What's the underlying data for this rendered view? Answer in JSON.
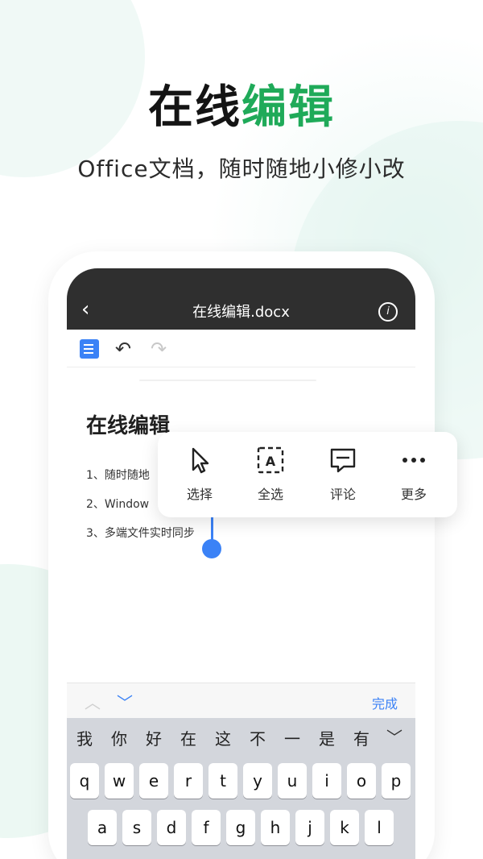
{
  "headline": {
    "part1": "在线",
    "part2": "编辑"
  },
  "subline": "Office文档，随时随地小修小改",
  "app": {
    "title": "在线编辑.docx",
    "back_icon": "chevron-left-icon",
    "info_icon": "info-icon",
    "toolbar": {
      "doc_icon": "document-icon",
      "undo_icon": "undo-icon",
      "redo_icon": "redo-icon"
    },
    "document": {
      "title": "在线编辑",
      "lines": [
        "1、随时随地",
        "2、Window",
        "3、多端文件实时同步"
      ]
    },
    "context_menu": [
      {
        "label": "选择",
        "icon": "cursor-icon"
      },
      {
        "label": "全选",
        "icon": "select-all-icon"
      },
      {
        "label": "评论",
        "icon": "comment-icon"
      },
      {
        "label": "更多",
        "icon": "more-icon"
      }
    ],
    "keyboard": {
      "done": "完成",
      "candidates": [
        "我",
        "你",
        "好",
        "在",
        "这",
        "不",
        "一",
        "是",
        "有"
      ],
      "row1": [
        "q",
        "w",
        "e",
        "r",
        "t",
        "y",
        "u",
        "i",
        "o",
        "p"
      ],
      "row2": [
        "a",
        "s",
        "d",
        "f",
        "g",
        "h",
        "j",
        "k",
        "l"
      ]
    }
  },
  "colors": {
    "accent_green": "#1faa59",
    "accent_blue": "#3b82f6",
    "topbar": "#2f2f2f"
  }
}
